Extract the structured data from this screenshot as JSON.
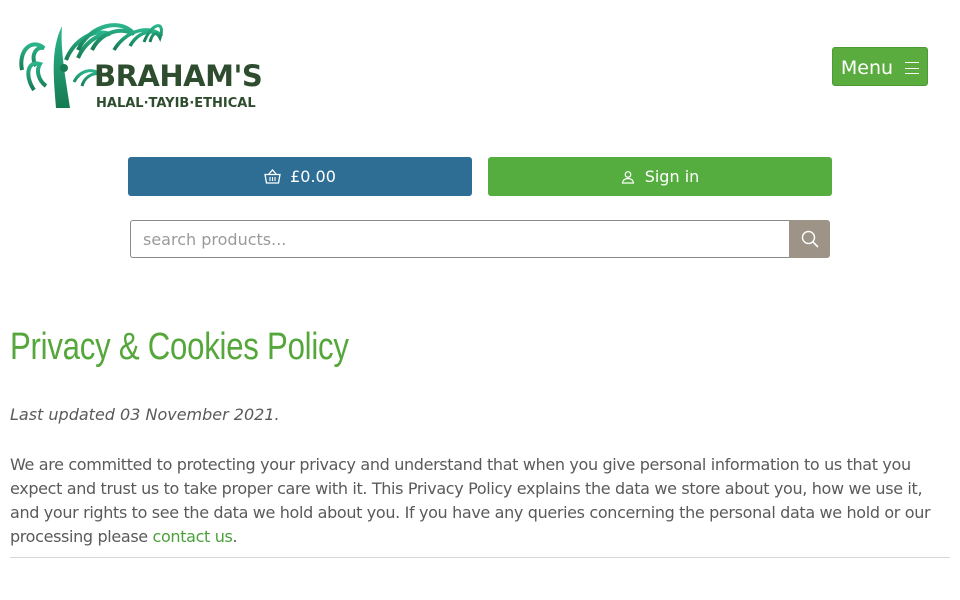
{
  "logo": {
    "word": "BRAHAM'S",
    "tagline": "HALAL·TAYIB·ETHICAL"
  },
  "header": {
    "menu_label": "Menu"
  },
  "basket": {
    "amount": "£0.00",
    "icon": "basket-icon"
  },
  "account": {
    "signin_label": "Sign in",
    "icon": "user-icon"
  },
  "search": {
    "placeholder": "search products...",
    "value": "",
    "icon": "search-icon"
  },
  "page": {
    "title": "Privacy & Cookies Policy",
    "last_updated": "Last updated 03 November 2021.",
    "intro_text": "We are committed to protecting your privacy and understand that when you give personal information to us that you expect and trust us to take proper care with it. This Privacy Policy explains the data we store about you, how we use it, and your rights to see the data we hold about you. If you have any queries concerning the personal data we hold or our processing please ",
    "contact_link": "contact us",
    "intro_end": "."
  },
  "colors": {
    "brand_green": "#5aac3f",
    "basket_blue": "#2e6e95",
    "search_button": "#9d9386",
    "title_green": "#55a73b",
    "logo_teal": "#1f9e7c",
    "logo_dark": "#2f4a2e"
  }
}
